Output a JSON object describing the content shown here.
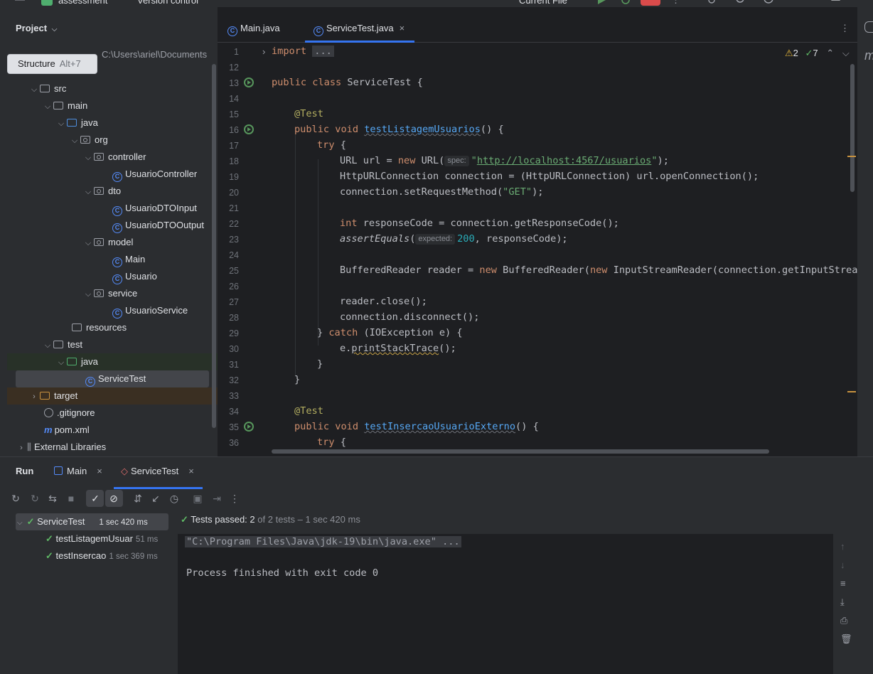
{
  "topbar": {
    "project_name": "assessment",
    "vcs_label": "Version control",
    "run_config": "Current File"
  },
  "project_panel": {
    "title": "Project",
    "root_path": "C:\\Users\\ariel\\Documents",
    "tooltip": {
      "label": "Structure",
      "shortcut": "Alt+7"
    },
    "tree": [
      {
        "label": "src"
      },
      {
        "label": "main"
      },
      {
        "label": "java"
      },
      {
        "label": "org"
      },
      {
        "label": "controller"
      },
      {
        "label": "UsuarioController"
      },
      {
        "label": "dto"
      },
      {
        "label": "UsuarioDTOInput"
      },
      {
        "label": "UsuarioDTOOutput"
      },
      {
        "label": "model"
      },
      {
        "label": "Main"
      },
      {
        "label": "Usuario"
      },
      {
        "label": "service"
      },
      {
        "label": "UsuarioService"
      },
      {
        "label": "resources"
      },
      {
        "label": "test"
      },
      {
        "label": "java"
      },
      {
        "label": "ServiceTest"
      },
      {
        "label": "target"
      },
      {
        "label": ".gitignore"
      },
      {
        "label": "pom.xml"
      },
      {
        "label": "External Libraries"
      }
    ]
  },
  "editor": {
    "tabs": [
      {
        "label": "Main.java"
      },
      {
        "label": "ServiceTest.java"
      }
    ],
    "warnings": "2",
    "weak_warnings": "7",
    "line_numbers": [
      "1",
      "12",
      "13",
      "14",
      "15",
      "16",
      "17",
      "18",
      "19",
      "20",
      "21",
      "22",
      "23",
      "24",
      "25",
      "26",
      "27",
      "28",
      "29",
      "30",
      "31",
      "32",
      "33",
      "34",
      "35",
      "36"
    ],
    "code": {
      "l1_kw": "import",
      "l1_fold": "...",
      "l13_a": "public class",
      "l13_b": " ServiceTest {",
      "l15": "@Test",
      "l16_kw": "public void",
      "l16_fn": "testListagemUsuarios",
      "l16_rest": "() {",
      "l17_kw": "try",
      "l17_rest": " {",
      "l18_a": "URL url = ",
      "l18_kw": "new",
      "l18_b": " URL(",
      "l18_hint": "spec:",
      "l18_q1": "\"",
      "l18_url": "http://localhost:4567/usuarios",
      "l18_q2": "\"",
      "l18_c": ");",
      "l19": "HttpURLConnection connection = (HttpURLConnection) url.openConnection();",
      "l20_a": "connection.setRequestMethod(",
      "l20_str": "\"GET\"",
      "l20_b": ");",
      "l22_kw": "int",
      "l22_rest": " responseCode = connection.getResponseCode();",
      "l23_fn": "assertEquals",
      "l23_a": "(",
      "l23_hint": "expected:",
      "l23_num": "200",
      "l23_b": ", responseCode);",
      "l25_a": "BufferedReader reader = ",
      "l25_kw1": "new",
      "l25_b": " BufferedReader(",
      "l25_kw2": "new",
      "l25_c": " InputStreamReader(connection.getInputStream(",
      "l27": "reader.close();",
      "l28": "connection.disconnect();",
      "l29_a": "} ",
      "l29_kw": "catch",
      "l29_b": " (IOException e) {",
      "l30_a": "e.",
      "l30_fn": "printStackTrace",
      "l30_b": "();",
      "l31": "}",
      "l32": "}",
      "l34": "@Test",
      "l35_kw": "public void",
      "l35_fn": "testInsercaoUsuarioExterno",
      "l35_rest": "() {",
      "l36_kw": "try",
      "l36_rest": " {"
    }
  },
  "run_panel": {
    "title": "Run",
    "tabs": [
      {
        "label": "Main"
      },
      {
        "label": "ServiceTest"
      }
    ],
    "tests": [
      {
        "name": "ServiceTest",
        "time": "1 sec 420 ms"
      },
      {
        "name": "testListagemUsuar",
        "time": "51 ms"
      },
      {
        "name": "testInsercao",
        "time": "1 sec 369 ms"
      }
    ],
    "status": {
      "label": "Tests passed:",
      "passed": "2",
      "of_total": "of 2 tests",
      "duration": "– 1 sec 420 ms"
    },
    "console": {
      "command": "\"C:\\Program Files\\Java\\jdk-19\\bin\\java.exe\" ...",
      "exit": "Process finished with exit code 0"
    }
  },
  "colors": {
    "accent": "#3574f0",
    "success": "#5fb865",
    "background": "#1e1f22",
    "panel": "#2b2d30"
  }
}
